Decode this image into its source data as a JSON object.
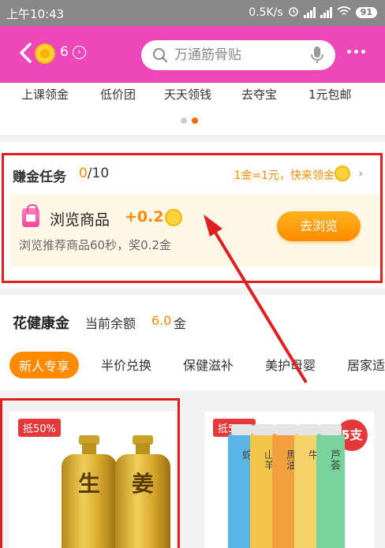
{
  "status_bar": {
    "time": "上午10:43",
    "network_speed": "0.5K/s",
    "battery": "91"
  },
  "header": {
    "coin_count": "6",
    "search_placeholder": "万通筋骨贴",
    "colors": {
      "background": "#ee47b9"
    }
  },
  "quick_nav": {
    "items": [
      "上课领金",
      "低价团",
      "天天领钱",
      "去夺宝",
      "1元包邮"
    ],
    "page_index": 1,
    "page_count": 2
  },
  "task": {
    "title": "赚金任务",
    "progress_current": "0",
    "progress_total": "/10",
    "rate_text": "1金=1元，快来领金",
    "card": {
      "name": "浏览商品",
      "reward": "+0.2",
      "description": "浏览推荐商品60秒，奖0.2金",
      "button_label": "去浏览"
    }
  },
  "health": {
    "title": "花健康金",
    "balance_label": "当前余额",
    "balance_value": "6.0",
    "balance_unit": "金",
    "tabs": [
      "新人专享",
      "半价兑换",
      "保健滋补",
      "美护母婴",
      "居家适"
    ],
    "active_tab": 0
  },
  "products": [
    {
      "discount_badge": "抵50%",
      "image_text": [
        "生",
        "姜"
      ]
    },
    {
      "discount_badge": "抵50%",
      "quantity_badge": "5支",
      "image_text": [
        "蛇",
        "山羊",
        "馬油",
        "牛",
        "芦荟"
      ]
    }
  ],
  "colors": {
    "accent_orange": "#ff8a00",
    "highlight_red": "#e02020",
    "header_pink": "#ee47b9"
  }
}
